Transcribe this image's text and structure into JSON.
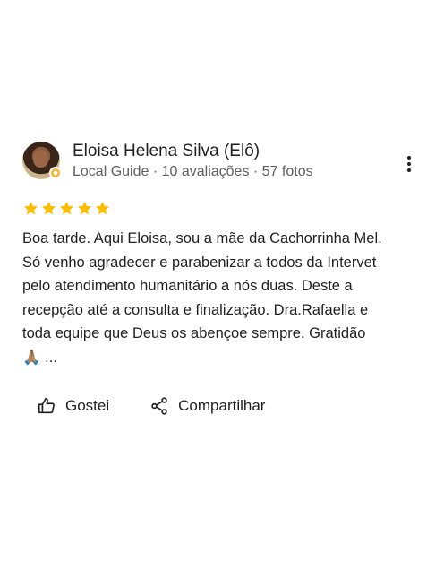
{
  "reviewer": {
    "name": "Eloisa Helena Silva (Elô)",
    "meta": "Local Guide · 10 avaliações · 57 fotos"
  },
  "rating": {
    "stars": 5,
    "max": 5,
    "star_color": "#fbbc04"
  },
  "review": {
    "lines": [
      "Boa tarde.  Aqui Eloisa, sou a mãe da Cachorrinha Mel.",
      "Só venho agradecer e parabenizar a todos da Intervet",
      "pelo atendimento humanitário a nós duas. Deste a",
      "recepção até a consulta e finalização. Dra.Rafaella e",
      "toda equipe que Deus os abençoe sempre.  Gratidão",
      "🙏🏽 ..."
    ]
  },
  "actions": {
    "like_label": "Gostei",
    "share_label": "Compartilhar"
  },
  "icons": {
    "menu": "more-vertical-icon",
    "like": "thumbs-up-icon",
    "share": "share-icon",
    "badge": "local-guide-badge-icon"
  }
}
